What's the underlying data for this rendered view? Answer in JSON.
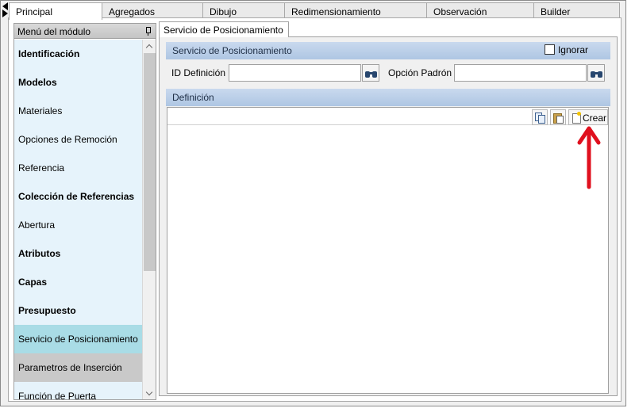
{
  "top_tabs": [
    "Principal",
    "Agregados",
    "Dibujo",
    "Redimensionamiento",
    "Observación",
    "Builder"
  ],
  "sidebar": {
    "title": "Menú del módulo",
    "items": [
      {
        "label": "Identificación",
        "bold": true
      },
      {
        "label": "Modelos",
        "bold": true
      },
      {
        "label": "Materiales",
        "bold": false
      },
      {
        "label": "Opciones de Remoción",
        "bold": false
      },
      {
        "label": "Referencia",
        "bold": false
      },
      {
        "label": "Colección de Referencias",
        "bold": true
      },
      {
        "label": "Abertura",
        "bold": false
      },
      {
        "label": "Atributos",
        "bold": true
      },
      {
        "label": "Capas",
        "bold": true
      },
      {
        "label": "Presupuesto",
        "bold": true
      },
      {
        "label": "Servicio de Posicionamiento",
        "bold": false,
        "state": "selected"
      },
      {
        "label": "Parametros de Inserción",
        "bold": false,
        "state": "hover"
      },
      {
        "label": "Función de Puerta",
        "bold": false
      }
    ]
  },
  "content": {
    "tab_label": "Servicio de Posicionamiento",
    "section_title": "Servicio de Posicionamiento",
    "ignore_label": "Ignorar",
    "ignore_checked": false,
    "id_definicion_label": "ID Definición",
    "id_definicion_value": "",
    "opcion_padron_label": "Opción Padrón",
    "opcion_padron_value": "",
    "definicion_title": "Definición",
    "crear_label": "Crear"
  },
  "colors": {
    "section_header": "#b9cfe9",
    "sidebar_bg": "#e6f3fb",
    "selected_item": "#a9dce6",
    "annotation_arrow": "#e0101e"
  }
}
